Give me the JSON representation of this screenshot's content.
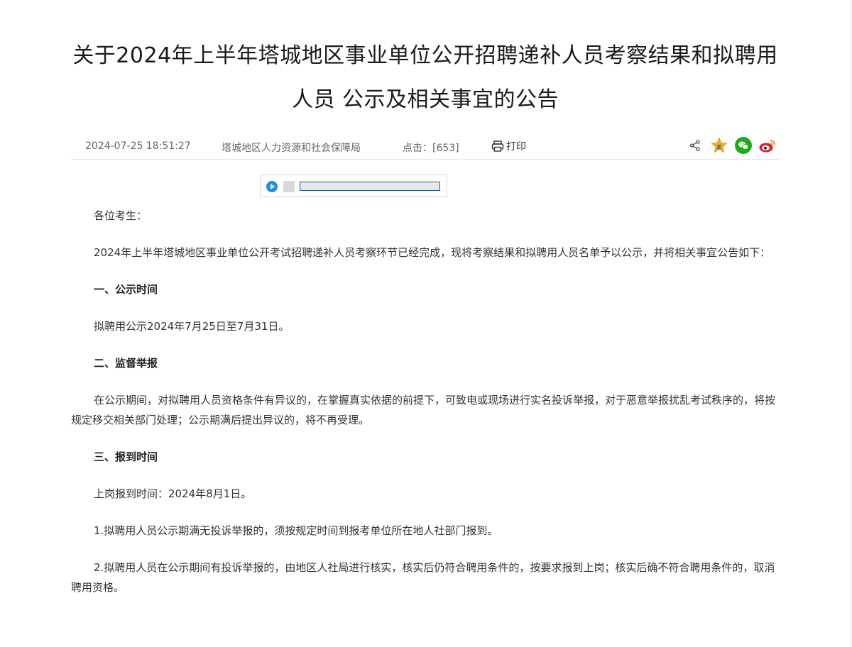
{
  "article": {
    "title_line1": "关于2024年上半年塔城地区事业单位公开招聘递补人员考察结果和拟聘用",
    "title_line2": "人员 公示及相关事宜的公告",
    "date": "2024-07-25 18:51:27",
    "source": "塔城地区人力资源和社会保障局",
    "hits": "点击：[653]",
    "print_label": "打印"
  },
  "share_icons": [
    "share-icon",
    "favorite-star-icon",
    "wechat-icon",
    "weibo-icon"
  ],
  "colors": {
    "player_accent": "#1a8fe3",
    "wechat": "#1aad19",
    "weibo": "#e6162d",
    "star": "#f5b400"
  },
  "audio": {
    "progress": 0
  },
  "body": {
    "salutation": "各位考生：",
    "intro": "2024年上半年塔城地区事业单位公开考试招聘递补人员考察环节已经完成，现将考察结果和拟聘用人员名单予以公示，并将相关事宜公告如下：",
    "s1_heading": "一、公示时间",
    "s1_text": "拟聘用公示2024年7月25日至7月31日。",
    "s2_heading": "二、监督举报",
    "s2_text": "在公示期间，对拟聘用人员资格条件有异议的，在掌握真实依据的前提下，可致电或现场进行实名投诉举报，对于恶意举报扰乱考试秩序的，将按规定移交相关部门处理；公示期满后提出异议的，将不再受理。",
    "s3_heading": "三、报到时间",
    "s3_text": "上岗报到时间：2024年8月1日。",
    "s3_item1": "1.拟聘用人员公示期满无投诉举报的，须按规定时间到报考单位所在地人社部门报到。",
    "s3_item2": "2.拟聘用人员在公示期间有投诉举报的，由地区人社局进行核实，核实后仍符合聘用条件的，按要求报到上岗；核实后确不符合聘用条件的，取消聘用资格。"
  }
}
